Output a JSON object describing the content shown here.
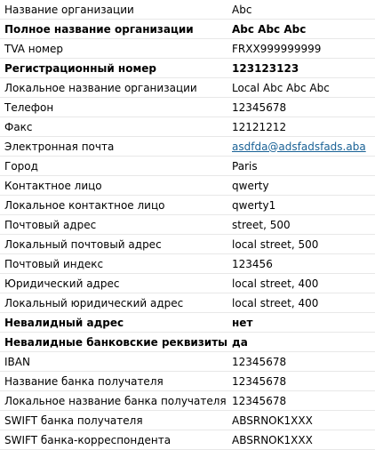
{
  "link_color": "#1a6296",
  "rows": [
    {
      "label": "Название организации",
      "value": "Abc",
      "bold": false
    },
    {
      "label": "Полное название организации",
      "value": "Abc Abc Abc",
      "bold": true
    },
    {
      "label": "TVA номер",
      "value": "FRXX999999999",
      "bold": false
    },
    {
      "label": "Регистрационный номер",
      "value": "123123123",
      "bold": true
    },
    {
      "label": "Локальное название организации",
      "value": "Local Abc Abc Abc",
      "bold": false
    },
    {
      "label": "Телефон",
      "value": "12345678",
      "bold": false
    },
    {
      "label": "Факс",
      "value": "12121212",
      "bold": false
    },
    {
      "label": "Электронная почта",
      "value": "asdfda@adsfadsfads.aba",
      "bold": false,
      "link": true
    },
    {
      "label": "Город",
      "value": "Paris",
      "bold": false
    },
    {
      "label": "Контактное лицо",
      "value": "qwerty",
      "bold": false
    },
    {
      "label": "Локальное контактное лицо",
      "value": "qwerty1",
      "bold": false
    },
    {
      "label": "Почтовый адрес",
      "value": "street, 500",
      "bold": false
    },
    {
      "label": "Локальный почтовый адрес",
      "value": "local street, 500",
      "bold": false
    },
    {
      "label": "Почтовый индекс",
      "value": "123456",
      "bold": false
    },
    {
      "label": "Юридический адрес",
      "value": "local street, 400",
      "bold": false
    },
    {
      "label": "Локальный юридический адрес",
      "value": "local street, 400",
      "bold": false
    },
    {
      "label": "Невалидный адрес",
      "value": "нет",
      "bold": true
    },
    {
      "label": "Невалидные банковские реквизиты",
      "value": "да",
      "bold": true
    },
    {
      "label": "IBAN",
      "value": "12345678",
      "bold": false
    },
    {
      "label": "Название банка получателя",
      "value": "12345678",
      "bold": false
    },
    {
      "label": "Локальное название банка получателя",
      "value": "12345678",
      "bold": false
    },
    {
      "label": "SWIFT банка получателя",
      "value": "ABSRNOK1XXX",
      "bold": false
    },
    {
      "label": "SWIFT банка-корреспондента",
      "value": "ABSRNOK1XXX",
      "bold": false
    }
  ]
}
